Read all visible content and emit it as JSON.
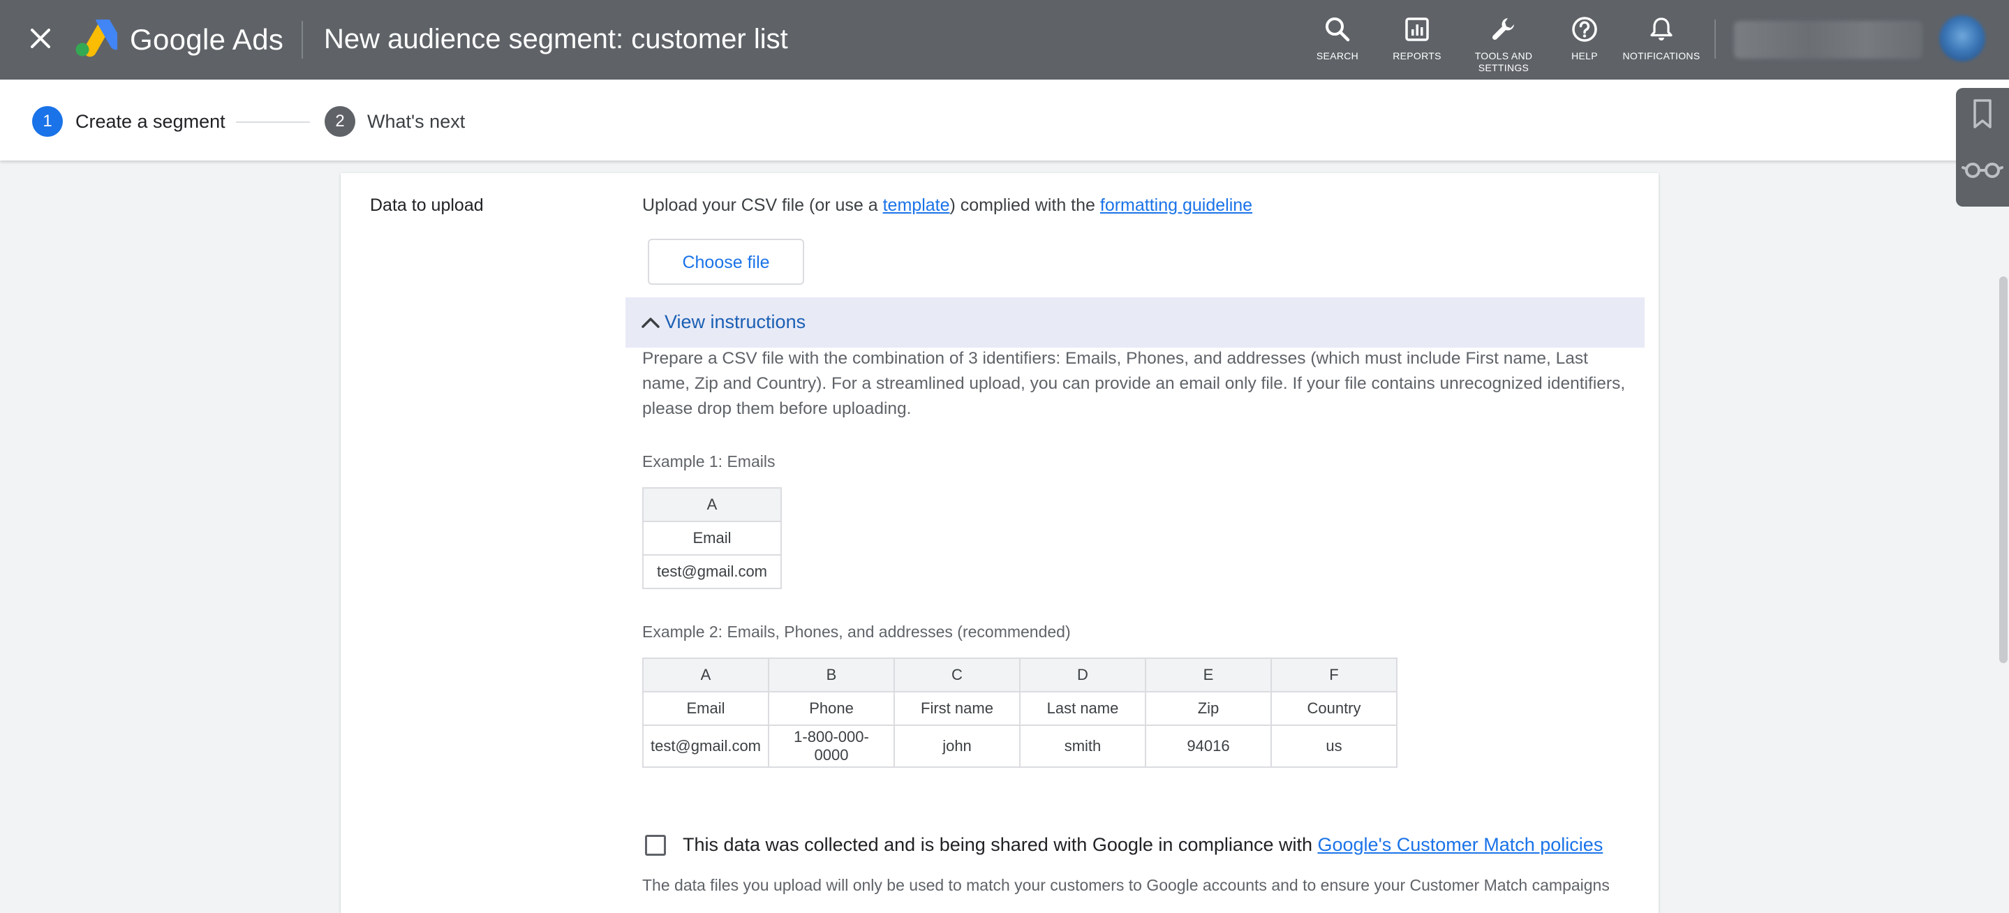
{
  "topbar": {
    "brand_word1": "Google",
    "brand_word2": "Ads",
    "page_title": "New audience segment: customer list",
    "tools": [
      {
        "label": "SEARCH",
        "icon": "search-icon"
      },
      {
        "label": "REPORTS",
        "icon": "reports-icon"
      },
      {
        "label": "TOOLS AND",
        "label2": "SETTINGS",
        "icon": "wrench-icon"
      },
      {
        "label": "HELP",
        "icon": "help-icon"
      },
      {
        "label": "NOTIFICATIONS",
        "icon": "bell-icon"
      }
    ],
    "colors": {
      "bar": "#5f6368",
      "text": "#ffffff"
    }
  },
  "stepper": {
    "steps": [
      {
        "number": "1",
        "label": "Create a segment",
        "state": "active"
      },
      {
        "number": "2",
        "label": "What's next",
        "state": "upcoming"
      }
    ],
    "accent": "#1a73e8"
  },
  "rail": {
    "items": [
      "bookmark-icon",
      "glasses-icon"
    ]
  },
  "card": {
    "section_label": "Data to upload",
    "upload": {
      "prefix": "Upload your CSV file (or use a ",
      "template_link": "template",
      "middle": ") complied with the ",
      "guideline_link": "formatting guideline"
    },
    "choose_file_label": "Choose file",
    "instructions_toggle": "View instructions",
    "instructions_body": "Prepare a CSV file with the combination of 3 identifiers: Emails, Phones, and addresses (which must include First name, Last name, Zip and Country). For a streamlined upload, you can provide an email only file. If your file contains unrecognized identifiers, please drop them before uploading.",
    "example1": {
      "title": "Example 1: Emails",
      "columns": [
        "A"
      ],
      "header_row": [
        "Email"
      ],
      "data_row": [
        "test@gmail.com"
      ]
    },
    "example2": {
      "title": "Example 2: Emails, Phones, and addresses (recommended)",
      "columns": [
        "A",
        "B",
        "C",
        "D",
        "E",
        "F"
      ],
      "header_row": [
        "Email",
        "Phone",
        "First name",
        "Last name",
        "Zip",
        "Country"
      ],
      "data_row": [
        "test@gmail.com",
        "1-800-000-0000",
        "john",
        "smith",
        "94016",
        "us"
      ]
    },
    "consent": {
      "text": "This data was collected and is being shared with Google in compliance with ",
      "link": "Google's Customer Match policies",
      "checked": false
    },
    "footnote": "The data files you upload will only be used to match your customers to Google accounts and to ensure your Customer Match campaigns"
  }
}
